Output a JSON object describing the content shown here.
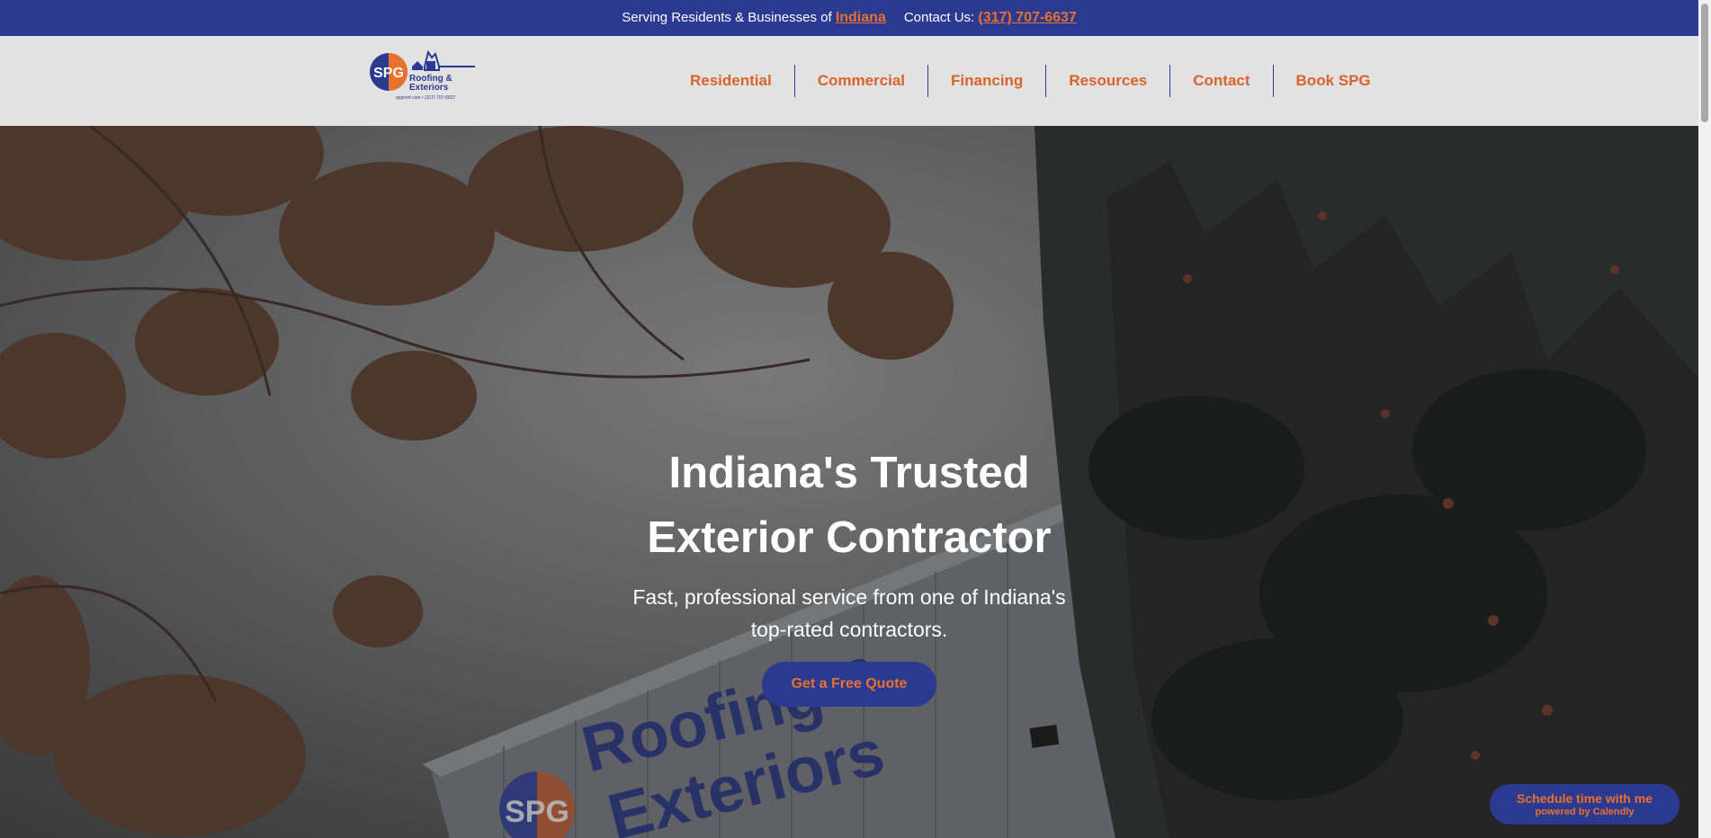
{
  "topbar": {
    "serving_text": "Serving Residents & Businesses of",
    "serving_link": "Indiana",
    "contact_text": "Contact Us:",
    "phone": "(317) 707-6637"
  },
  "logo": {
    "letters": "SPG",
    "line1": "Roofing &",
    "line2": "Exteriors",
    "tagline": "spgroof.com • (317) 707-6637"
  },
  "nav": {
    "items": [
      "Residential",
      "Commercial",
      "Financing",
      "Resources",
      "Contact",
      "Book SPG"
    ]
  },
  "hero": {
    "title_line1": "Indiana's Trusted",
    "title_line2": "Exterior Contractor",
    "subtitle_line1": "Fast, professional service from one of Indiana's",
    "subtitle_line2": "top-rated contractors.",
    "cta": "Get a Free Quote",
    "sign_text1": "Roofing &",
    "sign_text2": "Exteriors",
    "sign_letters": "SPG"
  },
  "calendly": {
    "line1": "Schedule time with me",
    "line2": "powered by Calendly"
  },
  "colors": {
    "brand_blue": "#2b3990",
    "brand_orange": "#e8712c",
    "header_bg": "#e2e2e2"
  }
}
